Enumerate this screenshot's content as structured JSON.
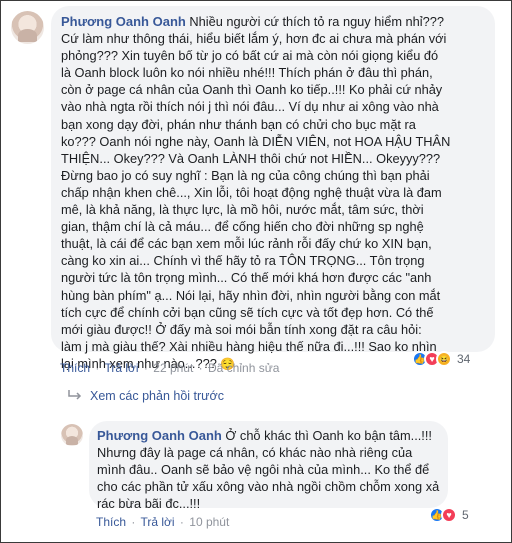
{
  "comment_main": {
    "author": "Phương Oanh Oanh",
    "text": "Nhiều người cứ thích tỏ ra nguy hiểm nhỉ???\nCứ làm như thông thái, hiểu biết lắm ý, hơn đc ai chưa mà phán với\nphỏng??? Xin tuyên bố từ jo có bất cứ ai mà còn nói giọng kiểu đó\nlà Oanh block luôn ko nói nhiều nhé!!! Thích phán ở đâu thì phán,\ncòn ở page cá nhân của Oanh thì Oanh ko tiếp..!!! Ko phải cứ nhảy\nvào nhà ngta rồi thích nói j thì nói đâu... Ví dụ như ai xông vào nhà\nbạn xong dạy đời, phán như thánh bạn có chửi cho bục mặt ra\nko??? Oanh nói nghe này, Oanh là DIỄN VIÊN, not HOA HẬU THÂN\nTHIỆN... Okey??? Và Oanh LÀNH thôi chứ not HIỀN... Okeyyy???\nĐừng bao jo có suy nghĩ : Bạn là ng của công chúng thì bạn phải\nchấp nhận khen chê..., Xin lỗi, tôi hoạt động nghệ thuật vừa là đam\nmê, là khả năng, là thực lực, là mồ hôi, nước mắt, tâm sức, thời\ngian, thậm chí là cả máu... để cống hiến cho đời những sp nghệ\nthuật, là cái để các bạn xem mỗi lúc rảnh rỗi đấy chứ ko XIN bạn,\ncàng ko xin ai... Chính vì thế hãy tỏ ra TÔN TRỌNG... Tôn trọng\nngười tức là tôn trọng mình... Có thế mới khá hơn được các \"anh\nhùng bàn phím\" ạ... Nói lại, hãy nhìn đời, nhìn người bằng con mắt\ntích cực để chính cởi bạn cũng sẽ tích cực và tốt đẹp hơn. Có thế\nmới giàu được!! Ở đấy mà soi mói bẫn tính xong đặt ra câu hỏi:\nlàm j mà giàu thế? Xài nhiều hàng hiệu thế nữa đi...!!! Sao ko nhìn\nlại mình xem như nào...??? ",
    "emoji": "😌",
    "actions": {
      "like": "Thích",
      "reply": "Trả lời",
      "time": "22 phút",
      "edited": "Đã chỉnh sửa"
    },
    "reaction_count": "34"
  },
  "previous_replies": {
    "label": "Xem các phản hồi trước"
  },
  "comment_reply": {
    "author": "Phương Oanh Oanh",
    "text": "Ở chỗ khác thì Oanh ko bận tâm...!!!\nNhưng đây là page cá nhân, có khác nào nhà riêng của\nmình đâu.. Oanh sẽ bảo vệ ngôi nhà của mình... Ko thể để\ncho các phần tử xấu xông vào nhà ngồi chồm chỗm xong xả\nrác bừa bãi đc...!!!",
    "actions": {
      "like": "Thích",
      "reply": "Trả lời",
      "time": "10 phút"
    },
    "reaction_count": "5"
  },
  "colors": {
    "link": "#385898",
    "bubble": "#f2f3f5",
    "meta": "#90949c"
  },
  "icons": {
    "like": "like-reaction-icon",
    "love": "love-reaction-icon",
    "haha": "haha-reaction-icon"
  }
}
